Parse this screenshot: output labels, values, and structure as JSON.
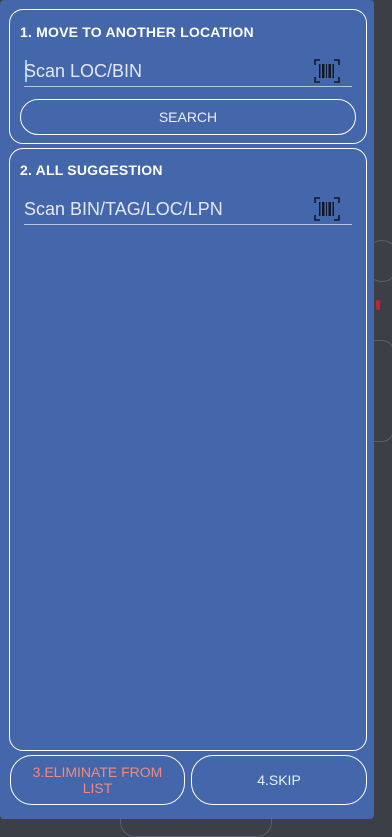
{
  "move_panel": {
    "title": "1. MOVE TO ANOTHER LOCATION",
    "input_placeholder": "Scan LOC/BIN",
    "search_label": "SEARCH"
  },
  "suggestion_panel": {
    "title": "2. ALL SUGGESTION",
    "input_placeholder": "Scan BIN/TAG/LOC/LPN"
  },
  "footer": {
    "eliminate_label": "3.ELIMINATE FROM LIST",
    "skip_label": "4.SKIP"
  },
  "colors": {
    "dialog_bg": "#4466ab",
    "eliminate_text": "#f08a80",
    "text": "#ffffff"
  }
}
